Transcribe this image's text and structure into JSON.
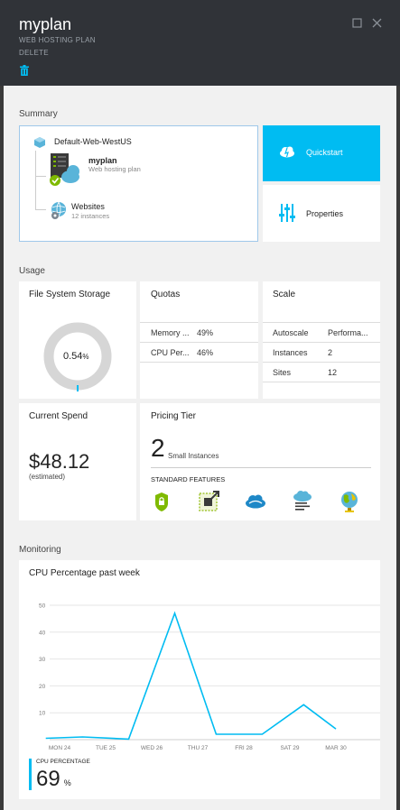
{
  "header": {
    "title": "myplan",
    "subtitle": "WEB HOSTING PLAN",
    "delete_label": "DELETE"
  },
  "summary": {
    "section_label": "Summary",
    "group_name": "Default-Web-WestUS",
    "plan_name": "myplan",
    "plan_type": "Web hosting plan",
    "websites_label": "Websites",
    "websites_count": "12 instances",
    "quickstart_label": "Quickstart",
    "properties_label": "Properties"
  },
  "usage": {
    "section_label": "Usage",
    "storage": {
      "title": "File System Storage",
      "value": "0.54",
      "unit": "%",
      "fraction": 0.0054
    },
    "quotas": {
      "title": "Quotas",
      "rows": [
        {
          "label": "Memory ...",
          "value": "49%"
        },
        {
          "label": "CPU Per...",
          "value": "46%"
        }
      ]
    },
    "scale": {
      "title": "Scale",
      "rows": [
        {
          "label": "Autoscale",
          "value": "Performa..."
        },
        {
          "label": "Instances",
          "value": "2"
        },
        {
          "label": "Sites",
          "value": "12"
        }
      ]
    },
    "spend": {
      "title": "Current Spend",
      "amount": "$48.12",
      "note": "(estimated)"
    },
    "pricing": {
      "title": "Pricing Tier",
      "count": "2",
      "count_label": "Small Instances",
      "features_label": "STANDARD FEATURES",
      "feature_icons": [
        "ssl-lock-icon",
        "custom-domain-icon",
        "cloud-backup-icon",
        "cloud-log-icon",
        "globe-icon"
      ]
    }
  },
  "monitoring": {
    "section_label": "Monitoring",
    "chart_title": "CPU Percentage past week",
    "legend_label": "CPU PERCENTAGE",
    "legend_value": "69",
    "legend_unit": "%"
  },
  "colors": {
    "accent": "#00bcf2",
    "header_bg": "#303338",
    "green": "#7fba00"
  },
  "chart_data": {
    "type": "line",
    "title": "CPU Percentage past week",
    "ylim": [
      0,
      50
    ],
    "y_ticks": [
      "10",
      "20",
      "30",
      "40",
      "50"
    ],
    "x_tick_labels": [
      "MON 24",
      "TUE 25",
      "WED 26",
      "THU 27",
      "FRI 28",
      "SAT 29",
      "MAR 30"
    ],
    "grid": true,
    "series": [
      {
        "name": "CPU PERCENTAGE",
        "color": "#00bcf2",
        "x": [
          -0.3,
          0.5,
          1.5,
          2.5,
          3.4,
          4.4,
          5.3,
          6.0
        ],
        "values": [
          0.5,
          1,
          0.2,
          47,
          2,
          2,
          13,
          4
        ]
      }
    ]
  }
}
